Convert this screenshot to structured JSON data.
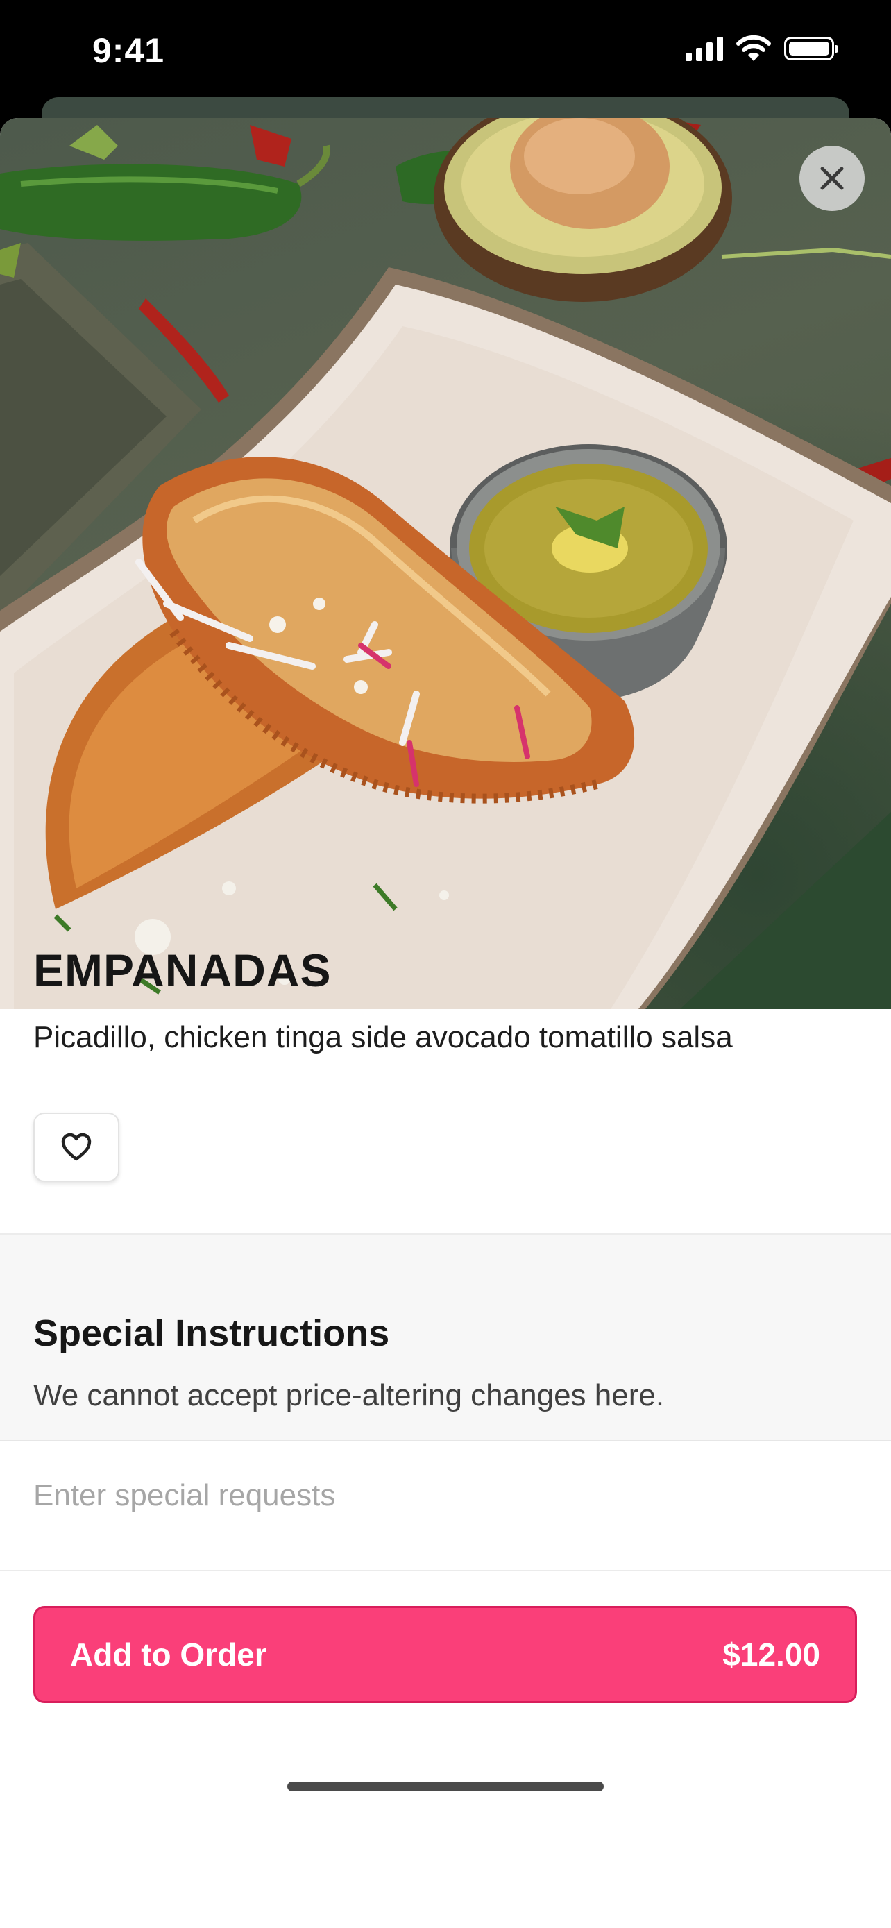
{
  "status_bar": {
    "time": "9:41"
  },
  "item": {
    "title": "EMPANADAS",
    "description": "Picadillo, chicken tinga side avocado tomatillo salsa"
  },
  "special_instructions": {
    "title": "Special Instructions",
    "subtitle": "We cannot accept price-altering changes here.",
    "placeholder": "Enter special requests",
    "value": ""
  },
  "add_to_order": {
    "label": "Add to Order",
    "price": "$12.00"
  },
  "colors": {
    "accent": "#fa3f79",
    "accent_border": "#d81e5b"
  },
  "icons": [
    "close-icon",
    "heart-icon",
    "signal-icon",
    "wifi-icon",
    "battery-icon"
  ]
}
